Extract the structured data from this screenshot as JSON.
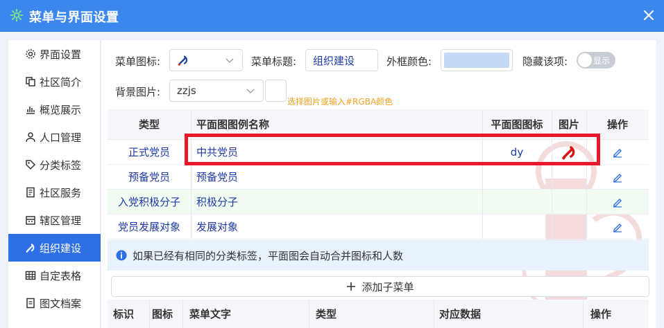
{
  "window": {
    "title": "菜单与界面设置",
    "icon": "gear-icon",
    "close_icon": "close-icon"
  },
  "colors": {
    "titlebar": "#3b87ee",
    "accent": "#2e6fe6",
    "highlight": "#e8192a",
    "hint": "#f0a020"
  },
  "sidebar": {
    "items": [
      {
        "label": "界面设置",
        "icon": "gear-icon"
      },
      {
        "label": "社区简介",
        "icon": "copy-icon"
      },
      {
        "label": "概览展示",
        "icon": "bar-chart-icon"
      },
      {
        "label": "人口管理",
        "icon": "user-icon"
      },
      {
        "label": "分类标签",
        "icon": "tag-icon"
      },
      {
        "label": "社区服务",
        "icon": "document-icon"
      },
      {
        "label": "辖区管理",
        "icon": "building-icon"
      },
      {
        "label": "组织建设",
        "icon": "party-emblem-icon",
        "active": true
      },
      {
        "label": "自定表格",
        "icon": "table-icon"
      },
      {
        "label": "图文档案",
        "icon": "file-icon"
      }
    ]
  },
  "form": {
    "menu_icon_label": "菜单图标:",
    "menu_icon_value": "party-emblem-icon",
    "menu_title_label": "菜单标题:",
    "menu_title_value": "组织建设",
    "frame_color_label": "外框颜色:",
    "frame_color_value": "#c5d9f7",
    "hide_label": "隐藏该项:",
    "hide_toggle_text": "显示",
    "bg_image_label": "背景图片:",
    "bg_image_value": "zzjs",
    "bg_hint": "选择图片或输入#RGBA颜色"
  },
  "legend_table": {
    "headers": [
      "类型",
      "平面图图例名称",
      "平面图图标",
      "图片",
      "操作"
    ],
    "rows": [
      {
        "type": "正式党员",
        "name": "中共党员",
        "map_icon": "dy",
        "has_image": true
      },
      {
        "type": "预备党员",
        "name": "预备党员",
        "map_icon": "",
        "has_image": false
      },
      {
        "type": "入党积极分子",
        "name": "积极分子",
        "map_icon": "",
        "has_image": false
      },
      {
        "type": "党员发展对象",
        "name": "发展对象",
        "map_icon": "",
        "has_image": false
      }
    ]
  },
  "info_text": "如果已经有相同的分类标签，平面图会自动合并图标和人数",
  "add_button_label": "添加子菜单",
  "submenu_table": {
    "headers": [
      "标识",
      "图标",
      "菜单文字",
      "类型",
      "对应数据",
      "操作"
    ]
  }
}
